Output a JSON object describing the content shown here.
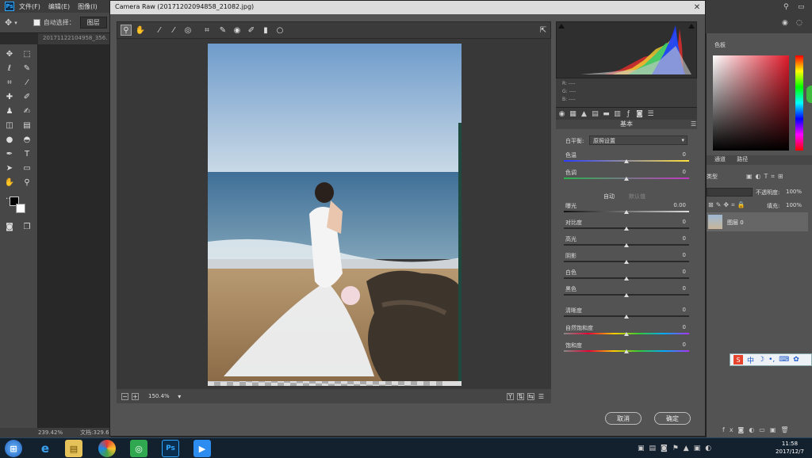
{
  "photoshop": {
    "menu": [
      "文件(F)",
      "编辑(E)",
      "图像(I)"
    ],
    "options": {
      "auto_select_label": "自动选择：",
      "auto_select_value": "图层"
    },
    "doc_tab": "20171122104958_356.",
    "status_zoom": "239.42%",
    "status_doc": "文档:329.6"
  },
  "dialog": {
    "title": "Camera Raw (20171202094858_21082.jpg)",
    "zoom_value": "150.4%",
    "histogram_readout": {
      "r": "R: ----",
      "g": "G: ----",
      "b": "B: ----"
    },
    "panel_title": "基本",
    "white_balance": {
      "label": "白平衡:",
      "value": "原照设置"
    },
    "sliders_wb": [
      {
        "label": "色温",
        "value": "0",
        "pos": 0.5
      },
      {
        "label": "色调",
        "value": "0",
        "pos": 0.5
      }
    ],
    "auto_label": "自动",
    "default_label": "默认值",
    "sliders_tone": [
      {
        "label": "曝光",
        "value": "0.00",
        "pos": 0.5
      },
      {
        "label": "对比度",
        "value": "0",
        "pos": 0.5
      },
      {
        "label": "高光",
        "value": "0",
        "pos": 0.5
      },
      {
        "label": "阴影",
        "value": "0",
        "pos": 0.5
      },
      {
        "label": "白色",
        "value": "0",
        "pos": 0.5
      },
      {
        "label": "黑色",
        "value": "0",
        "pos": 0.5
      }
    ],
    "sliders_presence": [
      {
        "label": "清晰度",
        "value": "0",
        "pos": 0.5
      },
      {
        "label": "自然饱和度",
        "value": "0",
        "pos": 0.5
      },
      {
        "label": "饱和度",
        "value": "0",
        "pos": 0.5
      }
    ],
    "cancel_label": "取消",
    "ok_label": "确定"
  },
  "right_panel": {
    "swatches_tab": "色板",
    "channels_tab": "通道",
    "paths_tab": "路径",
    "kind_label": "类型",
    "opacity_label": "不透明度:",
    "opacity_value": "100%",
    "fill_label": "填充:",
    "fill_value": "100%",
    "layer_name": "图层 0"
  },
  "ime": {
    "lang": "中"
  },
  "taskbar": {
    "time": "11:58",
    "date": "2017/12/7"
  },
  "colors": {
    "accent": "#31a8ff",
    "panel": "#535353",
    "dark": "#3b3b3b"
  }
}
